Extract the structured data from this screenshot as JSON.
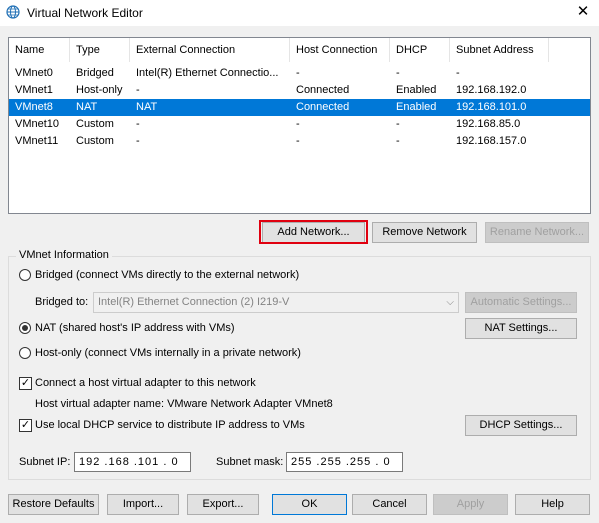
{
  "window": {
    "title": "Virtual Network Editor",
    "close_glyph": "✕"
  },
  "table": {
    "columns": [
      "Name",
      "Type",
      "External Connection",
      "Host Connection",
      "DHCP",
      "Subnet Address"
    ],
    "rows": [
      [
        "VMnet0",
        "Bridged",
        "Intel(R) Ethernet Connectio...",
        "-",
        "-",
        "-"
      ],
      [
        "VMnet1",
        "Host-only",
        "-",
        "Connected",
        "Enabled",
        "192.168.192.0"
      ],
      [
        "VMnet8",
        "NAT",
        "NAT",
        "Connected",
        "Enabled",
        "192.168.101.0"
      ],
      [
        "VMnet10",
        "Custom",
        "-",
        "-",
        "-",
        "192.168.85.0"
      ],
      [
        "VMnet11",
        "Custom",
        "-",
        "-",
        "-",
        "192.168.157.0"
      ]
    ],
    "selected_row": 2
  },
  "list_buttons": {
    "add": "Add Network...",
    "remove": "Remove Network",
    "rename": "Rename Network..."
  },
  "vmnet_info": {
    "legend": "VMnet Information",
    "bridged_label": "Bridged (connect VMs directly to the external network)",
    "bridged_to_label": "Bridged to:",
    "bridged_to_value": "Intel(R) Ethernet Connection (2) I219-V",
    "auto_settings": "Automatic Settings...",
    "nat_label": "NAT (shared host's IP address with VMs)",
    "nat_settings": "NAT Settings...",
    "hostonly_label": "Host-only (connect VMs internally in a private network)",
    "selected_mode": "nat",
    "connect_adapter_label": "Connect a host virtual adapter to this network",
    "connect_adapter_checked": true,
    "adapter_name_text": "Host virtual adapter name: VMware Network Adapter VMnet8",
    "dhcp_label": "Use local DHCP service to distribute IP address to VMs",
    "dhcp_checked": true,
    "dhcp_settings": "DHCP Settings...",
    "subnet_ip_label": "Subnet IP:",
    "subnet_ip": "192 .168 .101 . 0",
    "subnet_mask_label": "Subnet mask:",
    "subnet_mask": "255 .255 .255 . 0"
  },
  "footer": {
    "restore": "Restore Defaults",
    "import": "Import...",
    "export": "Export...",
    "ok": "OK",
    "cancel": "Cancel",
    "apply": "Apply",
    "help": "Help"
  },
  "colors": {
    "selection": "#0078d7",
    "highlight": "#e0000f"
  }
}
